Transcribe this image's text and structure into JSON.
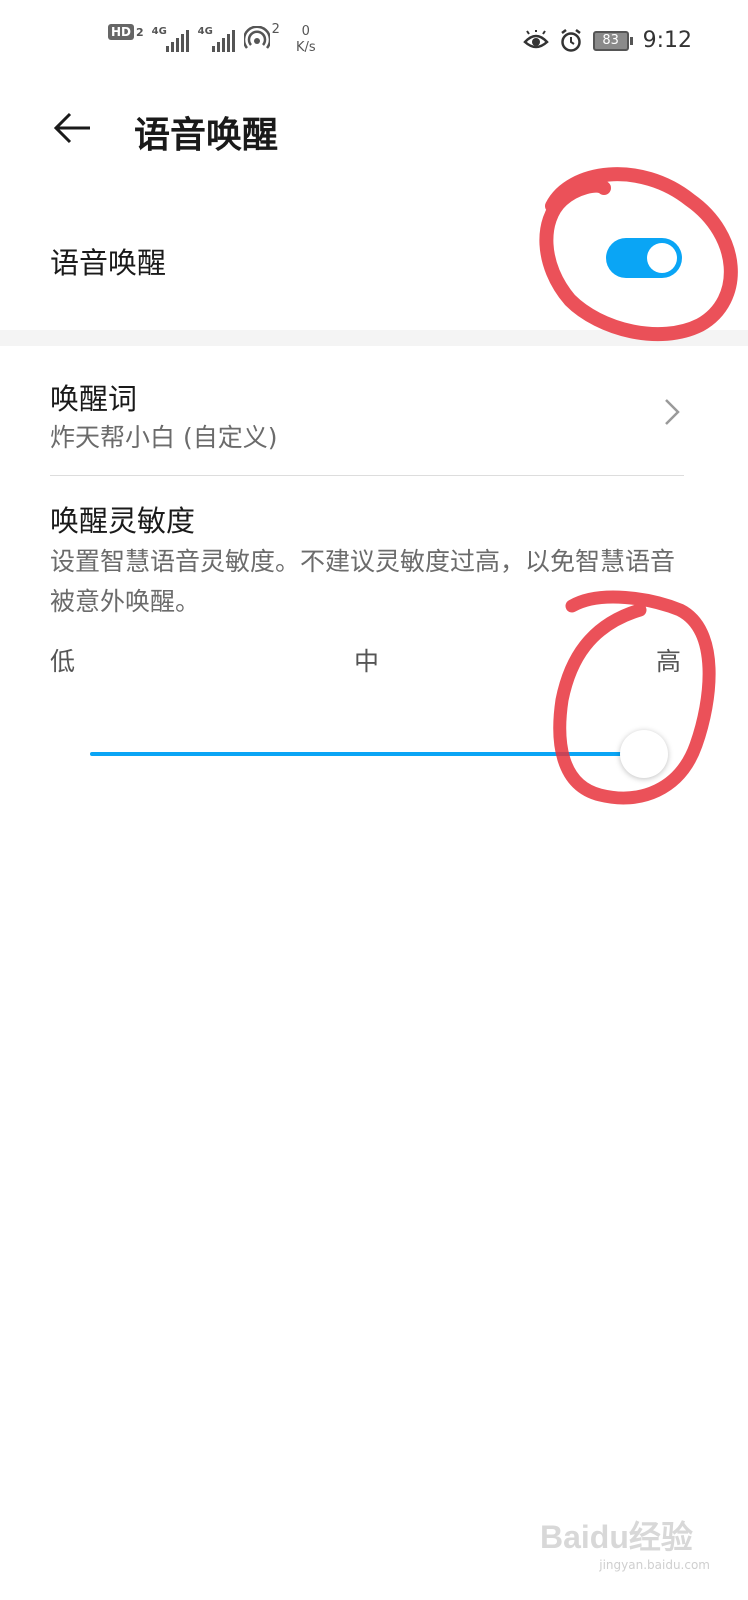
{
  "status_bar": {
    "hd_label": "HD",
    "hd_sub": "2",
    "signal1_label": "4G",
    "signal2_label": "4G",
    "hotspot_count": "2",
    "net_speed_value": "0",
    "net_speed_unit": "K/s",
    "battery": "83",
    "time": "9:12",
    "icons": [
      "hd-icon",
      "signal-icon",
      "signal-icon",
      "hotspot-icon",
      "eye-comfort-icon",
      "alarm-icon",
      "battery-icon"
    ]
  },
  "app_bar": {
    "back_icon": "back-arrow-icon",
    "title": "语音唤醒"
  },
  "toggle": {
    "label": "语音唤醒",
    "enabled": true,
    "accent_color": "#0AA5F5"
  },
  "wake_word": {
    "title": "唤醒词",
    "value": "炸天帮小白 (自定义)",
    "chevron_icon": "chevron-right-icon"
  },
  "sensitivity": {
    "title": "唤醒灵敏度",
    "description": "设置智慧语音灵敏度。不建议灵敏度过高，以免智慧语音被意外唤醒。",
    "tick_low": "低",
    "tick_mid": "中",
    "tick_high": "高",
    "level": "高",
    "level_fraction": 1.0
  },
  "annotation_color": "#E8333C",
  "watermark": {
    "logo": "Baidu经验",
    "url": "jingyan.baidu.com"
  }
}
